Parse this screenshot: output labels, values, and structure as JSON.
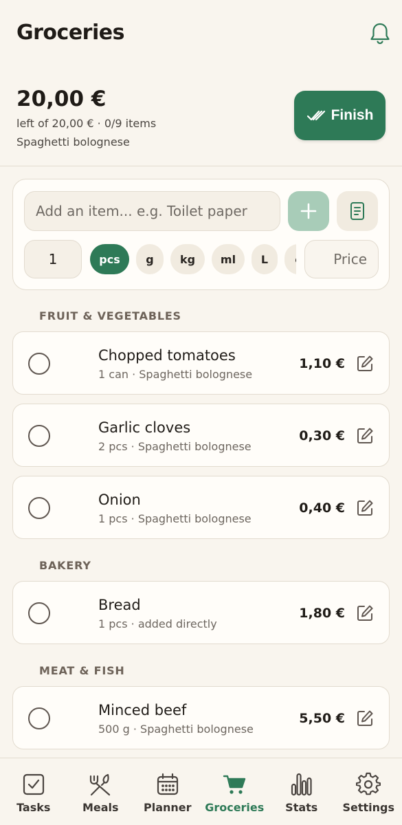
{
  "header": {
    "title": "Groceries",
    "bell_icon": "bell-icon"
  },
  "summary": {
    "amount": "20,00 €",
    "budget_line": "left of 20,00 € · 0/9 items",
    "recipe_line": "Spaghetti bolognese",
    "finish_label": "Finish",
    "finish_icon": "double-check-icon"
  },
  "add_item": {
    "placeholder": "Add an item... e.g. Toilet paper",
    "add_icon": "plus-icon",
    "notes_icon": "document-icon",
    "quantity": "1",
    "units": [
      "pcs",
      "g",
      "kg",
      "ml",
      "L",
      "c"
    ],
    "selected_unit": "pcs",
    "price_placeholder": "Price"
  },
  "sections": [
    {
      "title": "FRUIT & VEGETABLES",
      "items": [
        {
          "name": "Chopped tomatoes",
          "meta": "1 can · Spaghetti bolognese",
          "price": "1,10 €"
        },
        {
          "name": "Garlic cloves",
          "meta": "2 pcs · Spaghetti bolognese",
          "price": "0,30 €"
        },
        {
          "name": "Onion",
          "meta": "1 pcs · Spaghetti bolognese",
          "price": "0,40 €"
        }
      ]
    },
    {
      "title": "BAKERY",
      "items": [
        {
          "name": "Bread",
          "meta": "1 pcs · added directly",
          "price": "1,80 €"
        }
      ]
    },
    {
      "title": "MEAT & FISH",
      "items": [
        {
          "name": "Minced beef",
          "meta": "500 g · Spaghetti bolognese",
          "price": "5,50 €"
        }
      ]
    }
  ],
  "nav": {
    "active": "Groceries",
    "items": [
      {
        "label": "Tasks",
        "icon": "checkbox-icon"
      },
      {
        "label": "Meals",
        "icon": "fork-knife-icon"
      },
      {
        "label": "Planner",
        "icon": "calendar-icon"
      },
      {
        "label": "Groceries",
        "icon": "cart-icon"
      },
      {
        "label": "Stats",
        "icon": "bar-chart-icon"
      },
      {
        "label": "Settings",
        "icon": "gear-icon"
      }
    ]
  },
  "colors": {
    "accent": "#2e7a57",
    "background": "#f9f5ee",
    "card": "#fffdf9"
  }
}
